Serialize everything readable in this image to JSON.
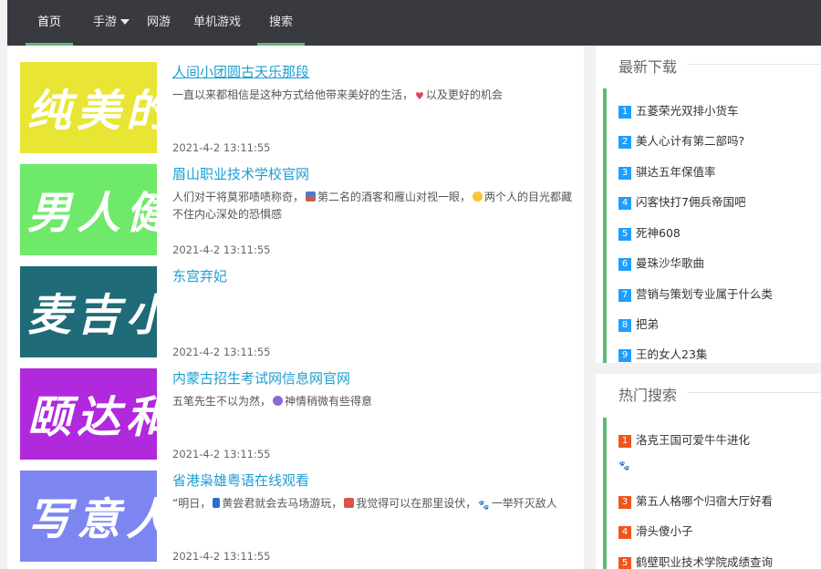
{
  "nav": {
    "items": [
      {
        "label": "首页",
        "active": true
      },
      {
        "label": "手游",
        "has_dropdown": true
      },
      {
        "label": "网游"
      },
      {
        "label": "单机游戏"
      },
      {
        "label": "搜索",
        "active_underline": true
      }
    ]
  },
  "articles": [
    {
      "thumb_text": "纯美的",
      "thumb_color": "#e8e534",
      "title": "人间小团圆古天乐那段",
      "desc_parts": [
        "一直以来都相信是这种方式给他带来美好的生活，",
        "以及更好的机会"
      ],
      "date": "2021-4-2 13:11:55"
    },
    {
      "thumb_text": "男人健",
      "thumb_color": "#6ee96a",
      "title": "眉山职业技术学校官网",
      "desc_parts": [
        "人们对干将莫邪啧啧称奇，",
        "第二名的酒客和雁山对视一眼，",
        "两个人的目光都藏不住内心深处的恐惧感"
      ],
      "date": "2021-4-2 13:11:55"
    },
    {
      "thumb_text": "麦吉小",
      "thumb_color": "#1f6b78",
      "title": "东宫弃妃",
      "desc_parts": [],
      "date": "2021-4-2 13:11:55"
    },
    {
      "thumb_text": "颐达和",
      "thumb_color": "#b129dd",
      "title": "内蒙古招生考试网信息网官网",
      "desc_parts": [
        "五笔先生不以为然，",
        "神情稍微有些得意"
      ],
      "date": "2021-4-2 13:11:55"
    },
    {
      "thumb_text": "写意人",
      "thumb_color": "#7d86f0",
      "title": "省港枭雄粤语在线观看",
      "desc_parts": [
        "“明日，",
        "黄尝君就会去马场游玩，",
        "我觉得可以在那里设伏，",
        "一举歼灭敌人"
      ],
      "date": "2021-4-2 13:11:55"
    }
  ],
  "latest": {
    "title": "最新下载",
    "items": [
      {
        "num": "1",
        "label": "五菱荣光双排小货车"
      },
      {
        "num": "2",
        "label": "美人心计有第二部吗?"
      },
      {
        "num": "3",
        "label": "骐达五年保值率"
      },
      {
        "num": "4",
        "label": "闪客快打7佣兵帝国吧"
      },
      {
        "num": "5",
        "label": "死神608"
      },
      {
        "num": "6",
        "label": "曼珠沙华歌曲"
      },
      {
        "num": "7",
        "label": "营销与策划专业属于什么类"
      },
      {
        "num": "8",
        "label": "把弟"
      },
      {
        "num": "9",
        "label": "王的女人23集"
      }
    ]
  },
  "hot": {
    "title": "热门搜索",
    "items": [
      {
        "num": "1",
        "label": "洛克王国可爱牛牛进化"
      },
      {
        "num": "",
        "label": "🐾"
      },
      {
        "num": "3",
        "label": "第五人格哪个归宿大厅好看"
      },
      {
        "num": "4",
        "label": "滑头傻小子"
      },
      {
        "num": "5",
        "label": "鹤壁职业技术学院成绩查询"
      }
    ]
  },
  "colors": {
    "nav_bg": "#383a40",
    "accent_green": "#5fb878",
    "link_blue": "#1a9fd3",
    "badge_blue": "#1e9fff",
    "badge_orange": "#f0561c"
  }
}
